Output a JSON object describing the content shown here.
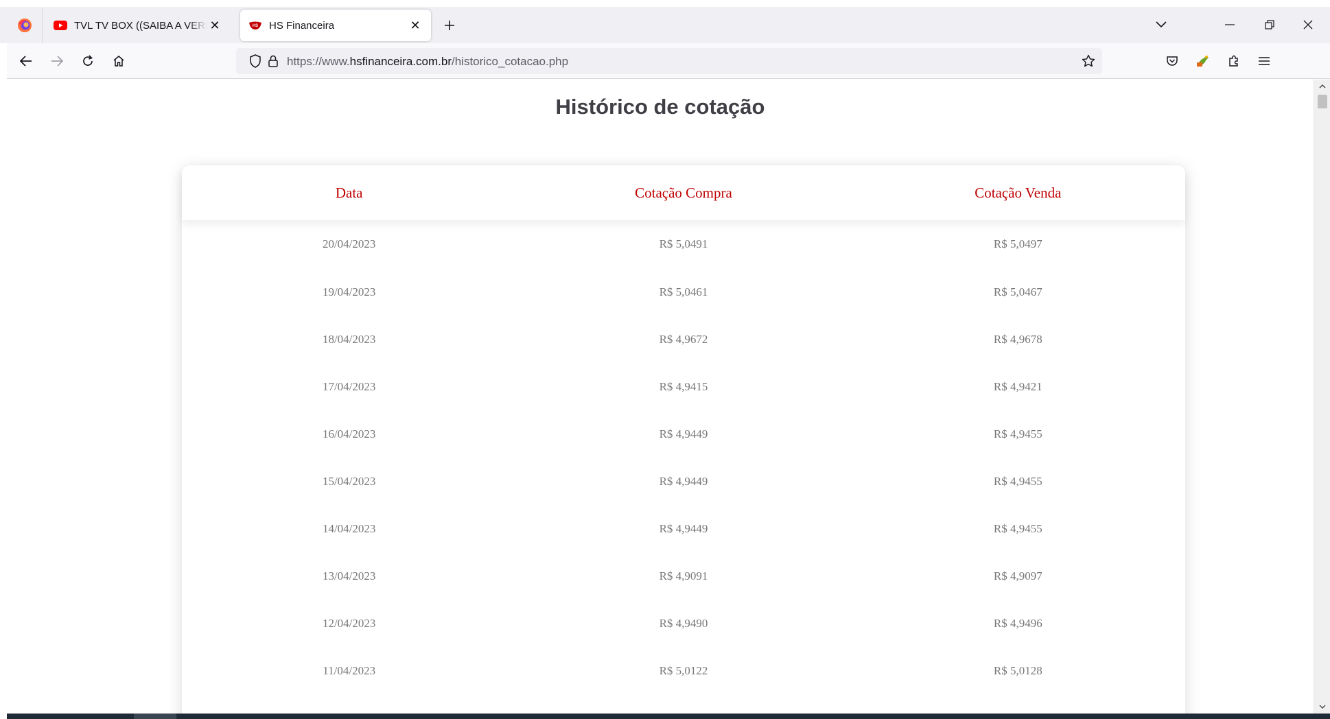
{
  "browser": {
    "tabs": [
      {
        "title": "TVL TV BOX ((SAIBA A VERDADE))",
        "favicon": "youtube-icon",
        "active": false
      },
      {
        "title": "HS Financeira",
        "favicon": "hs-financeira-icon",
        "active": true
      }
    ],
    "url": {
      "prefix": "https://www.",
      "domain": "hsfinanceira.com.br",
      "path": "/historico_cotacao.php"
    },
    "accent_color": "#c00000"
  },
  "page": {
    "title": "Histórico de cotação",
    "table": {
      "headers": [
        "Data",
        "Cotação Compra",
        "Cotação Venda"
      ],
      "rows": [
        [
          "20/04/2023",
          "R$ 5,0491",
          "R$ 5,0497"
        ],
        [
          "19/04/2023",
          "R$ 5,0461",
          "R$ 5,0467"
        ],
        [
          "18/04/2023",
          "R$ 4,9672",
          "R$ 4,9678"
        ],
        [
          "17/04/2023",
          "R$ 4,9415",
          "R$ 4,9421"
        ],
        [
          "16/04/2023",
          "R$ 4,9449",
          "R$ 4,9455"
        ],
        [
          "15/04/2023",
          "R$ 4,9449",
          "R$ 4,9455"
        ],
        [
          "14/04/2023",
          "R$ 4,9449",
          "R$ 4,9455"
        ],
        [
          "13/04/2023",
          "R$ 4,9091",
          "R$ 4,9097"
        ],
        [
          "12/04/2023",
          "R$ 4,9490",
          "R$ 4,9496"
        ],
        [
          "11/04/2023",
          "R$ 5,0122",
          "R$ 5,0128"
        ]
      ]
    }
  }
}
